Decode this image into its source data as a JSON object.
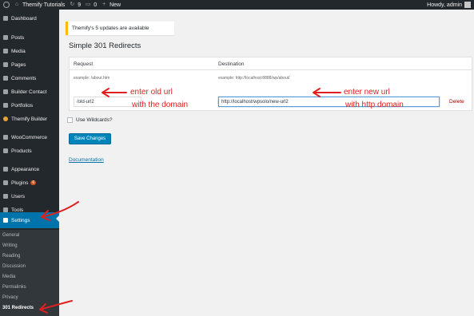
{
  "adminbar": {
    "site_name": "Themify Tutorials",
    "updates_count": "9",
    "comments_count": "0",
    "new_label": "New",
    "greeting": "Howdy, admin"
  },
  "sidebar": {
    "items": [
      {
        "label": "Dashboard",
        "icon": "dashboard-icon"
      },
      {
        "label": "Posts",
        "icon": "pin-icon"
      },
      {
        "label": "Media",
        "icon": "media-icon"
      },
      {
        "label": "Pages",
        "icon": "pages-icon"
      },
      {
        "label": "Comments",
        "icon": "comment-icon"
      },
      {
        "label": "Builder Contact",
        "icon": "pin-icon"
      },
      {
        "label": "Portfolios",
        "icon": "portfolio-icon"
      },
      {
        "label": "Themify Builder",
        "icon": "themify-icon"
      },
      {
        "label": "WooCommerce",
        "icon": "woocommerce-icon"
      },
      {
        "label": "Products",
        "icon": "products-icon"
      },
      {
        "label": "Appearance",
        "icon": "brush-icon"
      },
      {
        "label": "Plugins",
        "icon": "plugin-icon",
        "badge": "6"
      },
      {
        "label": "Users",
        "icon": "users-icon"
      },
      {
        "label": "Tools",
        "icon": "tools-icon"
      },
      {
        "label": "Settings",
        "icon": "settings-icon"
      }
    ],
    "submenu": [
      "General",
      "Writing",
      "Reading",
      "Discussion",
      "Media",
      "Permalinks",
      "Privacy",
      "301 Redirects"
    ]
  },
  "notice": {
    "text": "Themify's 5 updates are available"
  },
  "page": {
    "title": "Simple 301 Redirects"
  },
  "table": {
    "request_header": "Request",
    "destination_header": "Destination",
    "request_example": "example: /about.htm",
    "destination_example": "example: http://localhost:8888/wp/about/",
    "request_value": "/old-url2",
    "arrow": "»",
    "destination_value": "http://localhost/wpsolo/new-url2",
    "delete_label": "Delete"
  },
  "wildcards_label": "Use Wildcards?",
  "save_label": "Save Changes",
  "documentation_label": "Documentation",
  "annotations": {
    "old_url_line1": "enter old url",
    "old_url_line2": "with the domain",
    "new_url_line1": "enter new url",
    "new_url_line2": "with http domain"
  },
  "colors": {
    "adminbar": "#23282d",
    "sidebar": "#23282d",
    "accent": "#0073aa",
    "notice_border": "#ffb900",
    "annotation": "#e0201e",
    "delete": "#a00"
  }
}
